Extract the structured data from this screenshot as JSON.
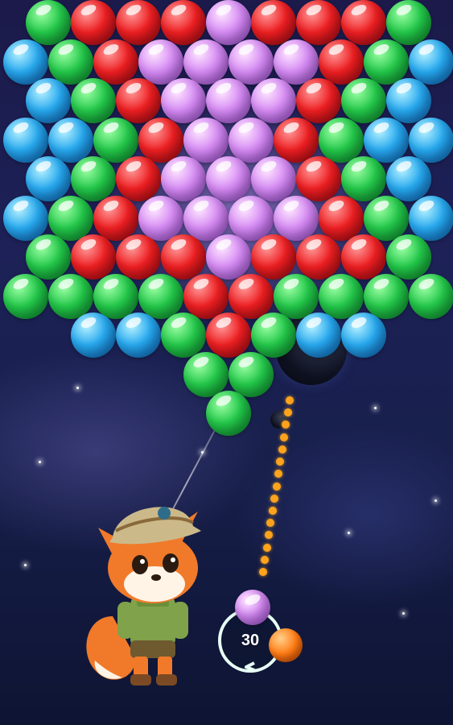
{
  "game": {
    "shots_remaining": "30",
    "current_bubble_color": "purple",
    "next_bubble_color": "orange",
    "mascot": "fox-explorer"
  },
  "colors": {
    "green": "#23c84a",
    "red": "#ee1f22",
    "blue": "#27a9ef",
    "purple": "#d68bf4",
    "orange": "#ff7a12",
    "aim_dots": "#ffa21c"
  },
  "board": {
    "rows": [
      [
        "G",
        "R",
        "R",
        "R",
        "P",
        "R",
        "R",
        "R",
        "G"
      ],
      [
        "B",
        "G",
        "R",
        "P",
        "P",
        "P",
        "P",
        "R",
        "G",
        "B"
      ],
      [
        "B",
        "G",
        "R",
        "P",
        "P",
        "P",
        "R",
        "G",
        "B"
      ],
      [
        "B",
        "B",
        "G",
        "R",
        "P",
        "P",
        "R",
        "G",
        "B",
        "B"
      ],
      [
        "B",
        "G",
        "R",
        "P",
        "P",
        "P",
        "R",
        "G",
        "B"
      ],
      [
        "B",
        "G",
        "R",
        "P",
        "P",
        "P",
        "P",
        "R",
        "G",
        "B"
      ],
      [
        "G",
        "R",
        "R",
        "R",
        "P",
        "R",
        "R",
        "R",
        "G"
      ],
      [
        "G",
        "G",
        "G",
        "G",
        "R",
        "R",
        "G",
        "G",
        "G",
        "G"
      ],
      [
        "",
        "B",
        "B",
        "G",
        "R",
        "G",
        "B",
        "B",
        ""
      ],
      [
        "",
        "",
        "",
        "",
        "G",
        "G",
        "",
        "",
        "",
        ""
      ],
      [
        "",
        "",
        "",
        "",
        "G",
        "",
        "",
        "",
        ""
      ]
    ]
  }
}
